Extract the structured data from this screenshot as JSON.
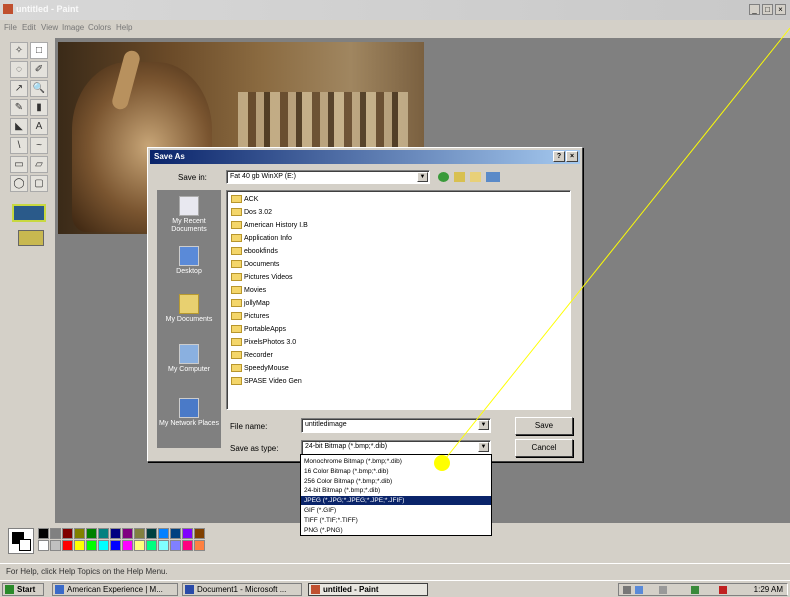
{
  "window": {
    "title": "untitled - Paint",
    "min": "_",
    "max": "□",
    "close": "×"
  },
  "menu": [
    "File",
    "Edit",
    "View",
    "Image",
    "Colors",
    "Help"
  ],
  "tools": [
    "✧",
    "□",
    "◌",
    "✐",
    "↗",
    "🔍",
    "✎",
    "▮",
    "A",
    "◣",
    "\\",
    "~",
    "▭",
    "▱",
    "◯",
    "▢"
  ],
  "status": {
    "text": "For Help, click Help Topics on the Help Menu."
  },
  "dialog": {
    "title": "Save As",
    "save_in_label": "Save in:",
    "save_in_value": "Fat 40 gb WinXP (E:)",
    "places": [
      {
        "name": "My Recent Documents"
      },
      {
        "name": "Desktop"
      },
      {
        "name": "My Documents"
      },
      {
        "name": "My Computer"
      },
      {
        "name": "My Network Places"
      }
    ],
    "files": [
      "ACK",
      "Dos 3.02",
      "American History I.B",
      "Application Info",
      "ebookfinds",
      "Documents",
      "Pictures Videos",
      "Movies",
      "jollyMap",
      "Pictures",
      "PortableApps",
      "PixelsPhotos 3.0",
      "Recorder",
      "SpeedyMouse",
      "SPASE Video Gen"
    ],
    "file_name_label": "File name:",
    "file_name_value": "untitledimage",
    "save_type_label": "Save as type:",
    "save_type_value": "24-bit Bitmap (*.bmp;*.dib)",
    "save_button": "Save",
    "cancel_button": "Cancel",
    "help_btn": "?",
    "close_btn": "×"
  },
  "type_options": [
    "Monochrome Bitmap (*.bmp;*.dib)",
    "16 Color Bitmap (*.bmp;*.dib)",
    "256 Color Bitmap (*.bmp;*.dib)",
    "24-bit Bitmap (*.bmp;*.dib)",
    "JPEG (*.JPG;*.JPEG;*.JPE;*.JFIF)",
    "GIF (*.GIF)",
    "TIFF (*.TIF;*.TIFF)",
    "PNG (*.PNG)"
  ],
  "selected_type_index": 4,
  "taskbar": {
    "start": "Start",
    "items": [
      "American Experience | M...",
      "Document1 - Microsoft ...",
      "untitled - Paint"
    ],
    "clock": "1:29 AM"
  },
  "colors": {
    "palette": [
      "#000000",
      "#808080",
      "#800000",
      "#808000",
      "#008000",
      "#008080",
      "#000080",
      "#800080",
      "#808040",
      "#004040",
      "#0080ff",
      "#004080",
      "#8000ff",
      "#804000",
      "#ffffff",
      "#c0c0c0",
      "#ff0000",
      "#ffff00",
      "#00ff00",
      "#00ffff",
      "#0000ff",
      "#ff00ff",
      "#ffff80",
      "#00ff80",
      "#80ffff",
      "#8080ff",
      "#ff0080",
      "#ff8040"
    ],
    "annotation": "#ffff00"
  }
}
